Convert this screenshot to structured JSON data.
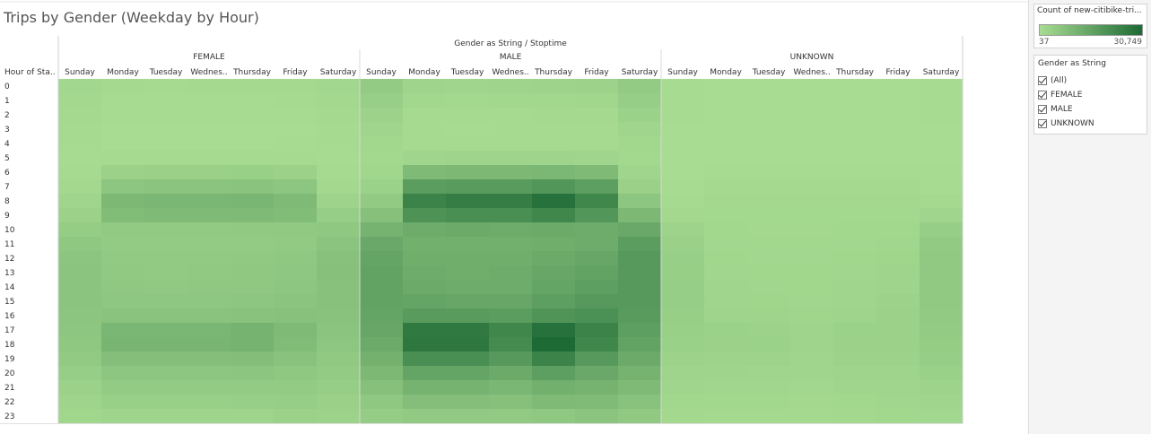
{
  "title": "Trips by Gender (Weekday by Hour)",
  "chart_data": {
    "type": "heatmap",
    "title": "Trips by Gender (Weekday by Hour)",
    "column_header": "Gender as String / Stoptime",
    "row_header": "Hour of Sta..",
    "groups": [
      "FEMALE",
      "MALE",
      "UNKNOWN"
    ],
    "day_labels": [
      "Sunday",
      "Monday",
      "Tuesday",
      "Wednes..",
      "Thursday",
      "Friday",
      "Saturday"
    ],
    "hours": [
      "0",
      "1",
      "2",
      "3",
      "4",
      "5",
      "6",
      "7",
      "8",
      "9",
      "10",
      "11",
      "12",
      "13",
      "14",
      "15",
      "16",
      "17",
      "18",
      "19",
      "20",
      "21",
      "22",
      "23"
    ],
    "values": {
      "FEMALE": [
        [
          1500,
          800,
          700,
          800,
          900,
          900,
          1500
        ],
        [
          1200,
          400,
          350,
          400,
          400,
          450,
          1200
        ],
        [
          900,
          200,
          200,
          200,
          250,
          250,
          900
        ],
        [
          700,
          150,
          120,
          150,
          150,
          150,
          700
        ],
        [
          500,
          150,
          150,
          150,
          150,
          180,
          500
        ],
        [
          400,
          500,
          500,
          500,
          500,
          500,
          400
        ],
        [
          600,
          3000,
          3200,
          3200,
          3300,
          3000,
          700
        ],
        [
          1000,
          6000,
          6500,
          6500,
          6700,
          6000,
          1200
        ],
        [
          2000,
          9500,
          10000,
          10000,
          10200,
          9000,
          2500
        ],
        [
          3000,
          8500,
          9000,
          9000,
          9000,
          8500,
          3800
        ],
        [
          4200,
          5000,
          5000,
          5000,
          5200,
          5200,
          5500
        ],
        [
          5500,
          4500,
          4500,
          4500,
          4600,
          4800,
          6500
        ],
        [
          6200,
          5000,
          5000,
          5000,
          5200,
          5500,
          7200
        ],
        [
          6500,
          5200,
          5000,
          5200,
          5300,
          5800,
          7500
        ],
        [
          6500,
          5300,
          5200,
          5300,
          5300,
          6000,
          7400
        ],
        [
          6400,
          5800,
          5800,
          5800,
          6000,
          6500,
          7300
        ],
        [
          6200,
          6800,
          6800,
          6800,
          7000,
          7200,
          7000
        ],
        [
          6000,
          10000,
          10000,
          10000,
          11000,
          9000,
          6500
        ],
        [
          5500,
          10500,
          10500,
          10500,
          11000,
          8500,
          6000
        ],
        [
          4800,
          8000,
          8000,
          8000,
          8300,
          7000,
          5200
        ],
        [
          3800,
          6000,
          6000,
          6000,
          6200,
          5500,
          4500
        ],
        [
          3000,
          4500,
          4500,
          4500,
          4600,
          4500,
          3800
        ],
        [
          2200,
          3300,
          3300,
          3300,
          3500,
          3800,
          3200
        ],
        [
          1600,
          2100,
          2100,
          2100,
          2300,
          3000,
          2600
        ]
      ],
      "MALE": [
        [
          4500,
          2200,
          2000,
          2200,
          2400,
          2600,
          4700
        ],
        [
          3500,
          1300,
          1100,
          1300,
          1400,
          1600,
          3700
        ],
        [
          2600,
          700,
          600,
          700,
          800,
          900,
          2800
        ],
        [
          1800,
          500,
          400,
          450,
          500,
          550,
          2000
        ],
        [
          1300,
          550,
          500,
          550,
          550,
          600,
          1400
        ],
        [
          1100,
          2000,
          2100,
          2100,
          2100,
          2000,
          1100
        ],
        [
          1600,
          9000,
          9500,
          9500,
          9700,
          9000,
          2000
        ],
        [
          2800,
          17000,
          17500,
          17500,
          19000,
          16500,
          3200
        ],
        [
          5000,
          24000,
          25500,
          25500,
          28500,
          23000,
          6000
        ],
        [
          7500,
          20000,
          21000,
          21000,
          23000,
          19000,
          9500
        ],
        [
          11000,
          13000,
          13500,
          13000,
          13500,
          13000,
          14000
        ],
        [
          14000,
          12000,
          12000,
          12000,
          12500,
          13000,
          17000
        ],
        [
          15000,
          12500,
          12500,
          12500,
          13500,
          14500,
          18000
        ],
        [
          15500,
          13000,
          12500,
          13000,
          14500,
          15500,
          18000
        ],
        [
          15500,
          13500,
          13000,
          13000,
          15000,
          16500,
          18000
        ],
        [
          15500,
          15000,
          14500,
          14500,
          16500,
          18000,
          18000
        ],
        [
          15000,
          17500,
          17500,
          17000,
          19500,
          20500,
          17500
        ],
        [
          14500,
          26500,
          26500,
          23000,
          28500,
          24000,
          16500
        ],
        [
          13500,
          27000,
          27000,
          22000,
          30749,
          23000,
          15500
        ],
        [
          11500,
          21000,
          21000,
          18000,
          24000,
          18000,
          13500
        ],
        [
          9500,
          15000,
          15000,
          13500,
          16500,
          14000,
          11000
        ],
        [
          7500,
          11000,
          11000,
          10000,
          12000,
          11000,
          9000
        ],
        [
          5500,
          8000,
          8000,
          7500,
          9000,
          8800,
          7000
        ],
        [
          4000,
          5000,
          5000,
          5000,
          5500,
          6500,
          5200
        ]
      ],
      "UNKNOWN": [
        [
          300,
          100,
          100,
          100,
          100,
          120,
          350
        ],
        [
          250,
          60,
          50,
          50,
          60,
          70,
          280
        ],
        [
          200,
          40,
          37,
          40,
          40,
          50,
          220
        ],
        [
          150,
          37,
          37,
          37,
          37,
          40,
          170
        ],
        [
          120,
          40,
          37,
          40,
          40,
          40,
          140
        ],
        [
          100,
          80,
          80,
          80,
          80,
          80,
          110
        ],
        [
          150,
          300,
          300,
          300,
          300,
          300,
          200
        ],
        [
          300,
          800,
          800,
          800,
          800,
          800,
          400
        ],
        [
          600,
          1200,
          1200,
          1200,
          1200,
          1200,
          900
        ],
        [
          1200,
          1100,
          1100,
          1100,
          1100,
          1100,
          1800
        ],
        [
          2400,
          1300,
          1200,
          1200,
          1300,
          1300,
          3800
        ],
        [
          3200,
          1500,
          1400,
          1400,
          1500,
          1700,
          4800
        ],
        [
          3500,
          1600,
          1500,
          1500,
          1600,
          1900,
          5100
        ],
        [
          3600,
          1700,
          1600,
          1600,
          1700,
          2100,
          5200
        ],
        [
          3700,
          1800,
          1700,
          1600,
          1800,
          2300,
          5200
        ],
        [
          3700,
          2000,
          1900,
          1700,
          2000,
          2600,
          5100
        ],
        [
          3600,
          2300,
          2200,
          1900,
          2300,
          2900,
          4900
        ],
        [
          3400,
          2800,
          2700,
          2100,
          2800,
          3000,
          4600
        ],
        [
          3100,
          2900,
          2800,
          2100,
          2900,
          2900,
          4200
        ],
        [
          2700,
          2500,
          2400,
          2000,
          2600,
          2600,
          3700
        ],
        [
          2200,
          2100,
          2000,
          1800,
          2200,
          2300,
          3100
        ],
        [
          1800,
          1700,
          1700,
          1500,
          1800,
          2000,
          2500
        ],
        [
          1400,
          1300,
          1300,
          1200,
          1400,
          1700,
          2000
        ],
        [
          1000,
          900,
          900,
          900,
          1000,
          1400,
          1500
        ]
      ]
    },
    "color_scale": {
      "min": 37,
      "max": 30749,
      "low_color": "#a8dc92",
      "high_color": "#1d6a35"
    }
  },
  "legend": {
    "title": "Count of new-citibike-tri...",
    "min_label": "37",
    "max_label": "30,749"
  },
  "filter": {
    "title": "Gender as String",
    "items": [
      {
        "label": "(All)",
        "checked": true
      },
      {
        "label": "FEMALE",
        "checked": true
      },
      {
        "label": "MALE",
        "checked": true
      },
      {
        "label": "UNKNOWN",
        "checked": true
      }
    ]
  }
}
